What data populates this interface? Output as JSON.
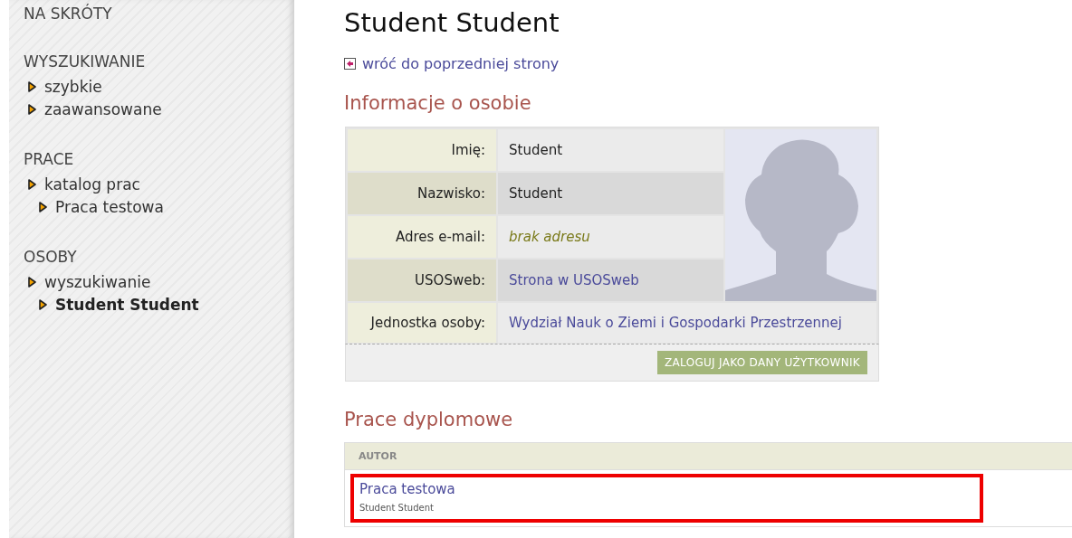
{
  "sidebar": {
    "sections": [
      {
        "title": "NA SKRÓTY"
      },
      {
        "title": "WYSZUKIWANIE",
        "items": [
          {
            "label": "szybkie",
            "selected": false
          },
          {
            "label": "zaawansowane",
            "selected": false
          }
        ]
      },
      {
        "title": "PRACE",
        "items": [
          {
            "label": "katalog prac",
            "selected": false,
            "children": [
              {
                "label": "Praca testowa",
                "selected": false
              }
            ]
          }
        ]
      },
      {
        "title": "OSOBY",
        "items": [
          {
            "label": "wyszukiwanie",
            "selected": false,
            "children": [
              {
                "label": "Student Student",
                "selected": true
              }
            ]
          }
        ]
      }
    ]
  },
  "page": {
    "title": "Student Student",
    "back_link": "wróć do poprzedniej strony"
  },
  "person": {
    "heading": "Informacje o osobie",
    "rows": [
      {
        "label": "Imię:",
        "value": "Student",
        "kind": "text"
      },
      {
        "label": "Nazwisko:",
        "value": "Student",
        "kind": "text"
      },
      {
        "label": "Adres e-mail:",
        "value": "brak adresu",
        "kind": "empty"
      },
      {
        "label": "USOSweb:",
        "value": "Strona w USOSweb",
        "kind": "link"
      },
      {
        "label": "Jednostka osoby:",
        "value": "Wydział Nauk o Ziemi i Gospodarki Przestrzennej",
        "kind": "link"
      }
    ],
    "button": "ZALOGUJ JAKO DANY UŻYTKOWNIK"
  },
  "theses": {
    "heading": "Prace dyplomowe",
    "columns": [
      "AUTOR"
    ],
    "rows": [
      {
        "title": "Praca testowa",
        "author": "Student Student",
        "highlighted": true
      }
    ]
  }
}
